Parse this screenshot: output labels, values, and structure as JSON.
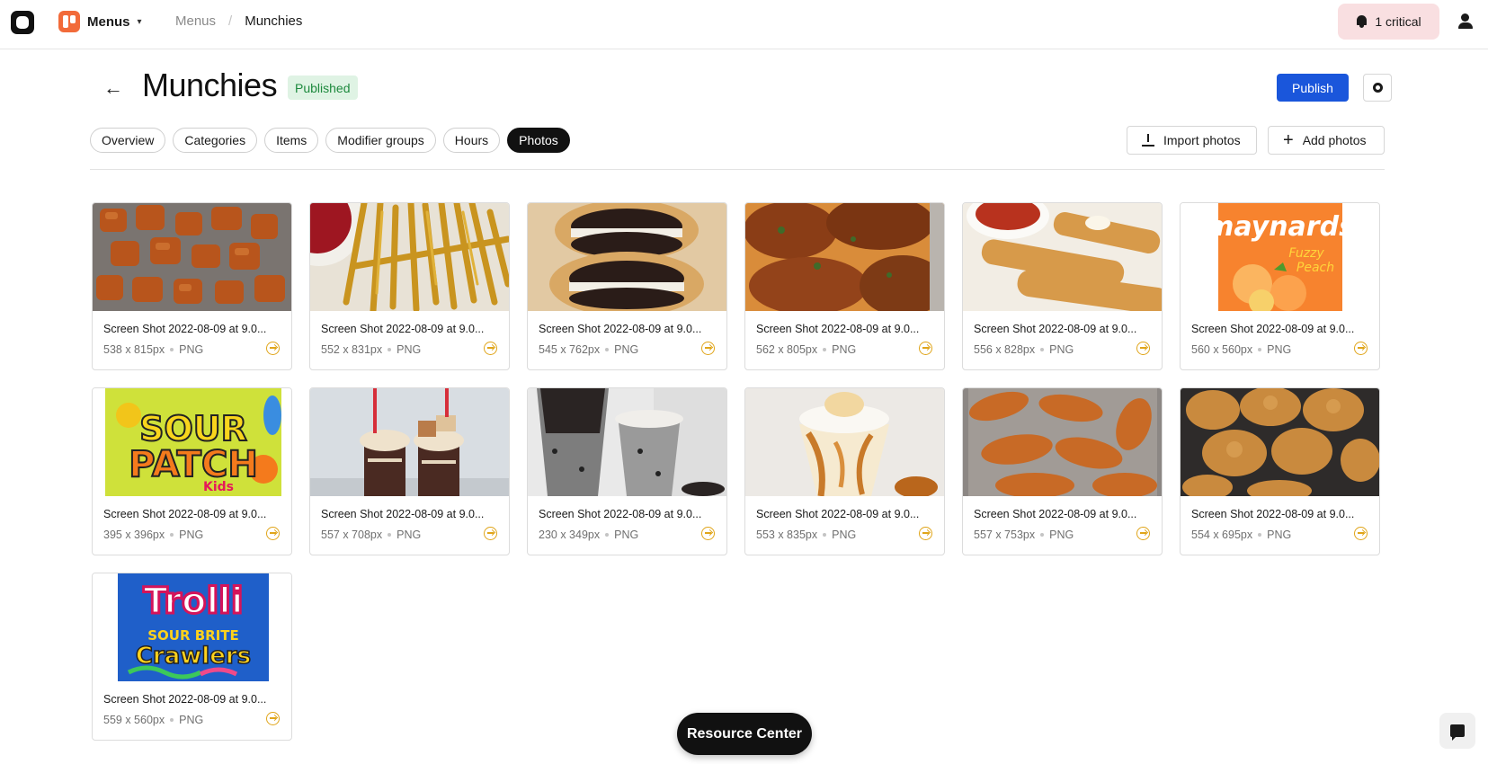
{
  "nav": {
    "app_name": "Menus",
    "breadcrumbs": [
      "Menus",
      "/",
      "Munchies"
    ],
    "alert_label": "1 critical"
  },
  "header": {
    "title": "Munchies",
    "status": "Published",
    "publish_label": "Publish"
  },
  "tabs": [
    "Overview",
    "Categories",
    "Items",
    "Modifier groups",
    "Hours",
    "Photos"
  ],
  "active_tab": "Photos",
  "actions": {
    "import_label": "Import photos",
    "add_label": "Add photos"
  },
  "photos": [
    {
      "name": "Screen Shot 2022-08-09 at 9.0...",
      "dims": "538 x 815px",
      "type": "PNG"
    },
    {
      "name": "Screen Shot 2022-08-09 at 9.0...",
      "dims": "552 x 831px",
      "type": "PNG"
    },
    {
      "name": "Screen Shot 2022-08-09 at 9.0...",
      "dims": "545 x 762px",
      "type": "PNG"
    },
    {
      "name": "Screen Shot 2022-08-09 at 9.0...",
      "dims": "562 x 805px",
      "type": "PNG"
    },
    {
      "name": "Screen Shot 2022-08-09 at 9.0...",
      "dims": "556 x 828px",
      "type": "PNG"
    },
    {
      "name": "Screen Shot 2022-08-09 at 9.0...",
      "dims": "560 x 560px",
      "type": "PNG"
    },
    {
      "name": "Screen Shot 2022-08-09 at 9.0...",
      "dims": "395 x 396px",
      "type": "PNG"
    },
    {
      "name": "Screen Shot 2022-08-09 at 9.0...",
      "dims": "557 x 708px",
      "type": "PNG"
    },
    {
      "name": "Screen Shot 2022-08-09 at 9.0...",
      "dims": "230 x 349px",
      "type": "PNG"
    },
    {
      "name": "Screen Shot 2022-08-09 at 9.0...",
      "dims": "553 x 835px",
      "type": "PNG"
    },
    {
      "name": "Screen Shot 2022-08-09 at 9.0...",
      "dims": "557 x 753px",
      "type": "PNG"
    },
    {
      "name": "Screen Shot 2022-08-09 at 9.0...",
      "dims": "554 x 695px",
      "type": "PNG"
    },
    {
      "name": "Screen Shot 2022-08-09 at 9.0...",
      "dims": "559 x 560px",
      "type": "PNG"
    }
  ],
  "resource_center_label": "Resource Center",
  "icons": {
    "swap": "swap-icon",
    "back": "arrow-left-icon",
    "settings": "gear-icon",
    "alert": "bell-icon",
    "user": "user-icon",
    "chat": "chat-icon"
  },
  "colors": {
    "primary": "#1a56db",
    "published_bg": "#dff3e4",
    "published_text": "#1e8a3e",
    "alert_bg": "#f9dfe1",
    "swap_icon": "#e0a51a",
    "brand_orange": "#f26b3a"
  }
}
